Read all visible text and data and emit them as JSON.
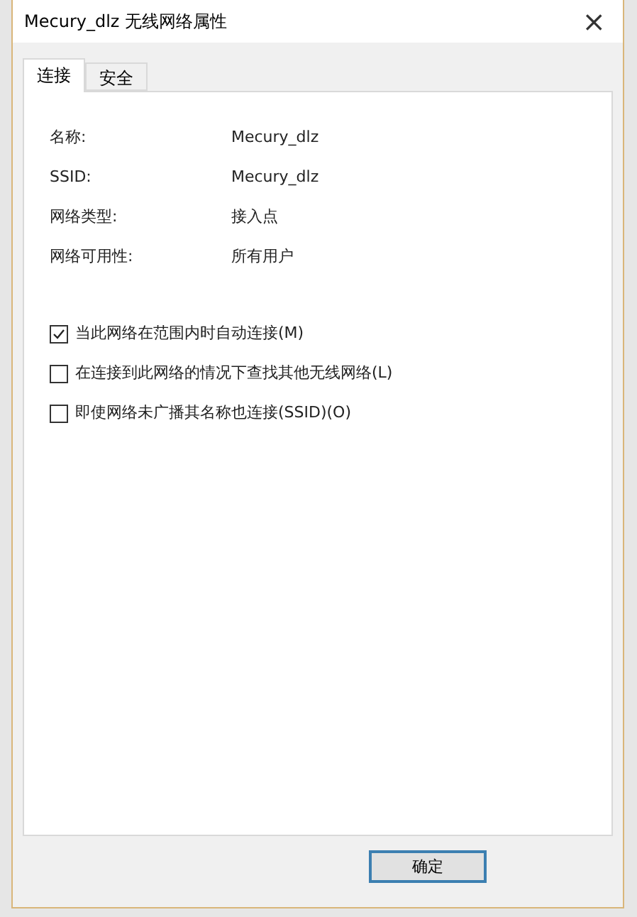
{
  "window": {
    "title": "Mecury_dlz 无线网络属性",
    "close": "×"
  },
  "tabs": [
    {
      "label": "连接",
      "selected": true
    },
    {
      "label": "安全",
      "selected": false
    }
  ],
  "properties": [
    {
      "label": "名称:",
      "value": "Mecury_dlz"
    },
    {
      "label": "SSID:",
      "value": "Mecury_dlz"
    },
    {
      "label": "网络类型:",
      "value": "接入点"
    },
    {
      "label": "网络可用性:",
      "value": "所有用户"
    }
  ],
  "options": [
    {
      "label": "当此网络在范围内时自动连接(M)",
      "checked": true
    },
    {
      "label": "在连接到此网络的情况下查找其他无线网络(L)",
      "checked": false
    },
    {
      "label": "即使网络未广播其名称也连接(SSID)(O)",
      "checked": false
    }
  ],
  "buttons": [
    {
      "label": "确定"
    }
  ]
}
